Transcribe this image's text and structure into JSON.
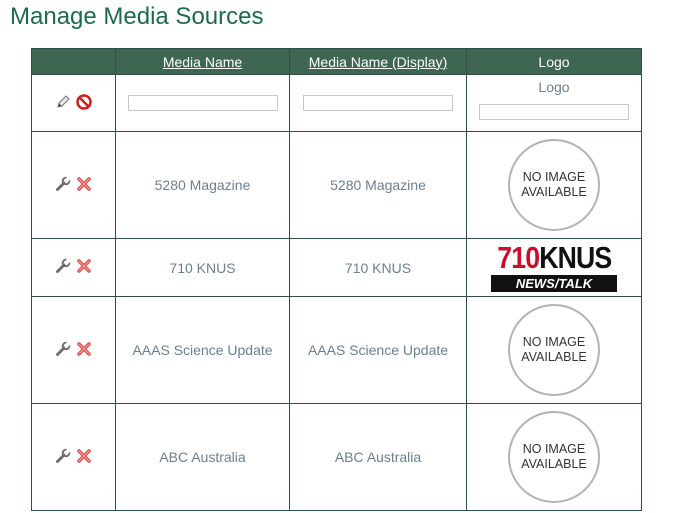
{
  "page": {
    "title": "Manage Media Sources"
  },
  "table": {
    "headers": {
      "media_name": "Media Name",
      "media_name_display": "Media Name (Display)",
      "logo": "Logo"
    },
    "filter": {
      "logo_label": "Logo"
    },
    "no_image": {
      "line1": "NO IMAGE",
      "line2": "AVAILABLE"
    },
    "rows": [
      {
        "name": "5280 Magazine",
        "display": "5280 Magazine",
        "logo": "none"
      },
      {
        "name": "710 KNUS",
        "display": "710 KNUS",
        "logo": "710-knus"
      },
      {
        "name": "AAAS Science Update",
        "display": "AAAS Science Update",
        "logo": "none"
      },
      {
        "name": "ABC Australia",
        "display": "ABC Australia",
        "logo": "none"
      }
    ]
  },
  "knus_logo": {
    "number": "710",
    "name": "KNUS",
    "tagline": "NEWS/TALK"
  },
  "icons": {
    "filter_apply": "pencil-icon",
    "filter_clear": "cancel-icon",
    "edit": "wrench-icon",
    "delete": "delete-x-icon"
  },
  "colors": {
    "header_bg": "#3e6650",
    "title": "#1e6b4a",
    "cell_text": "#6b7f8e",
    "delete": "#d9534f"
  }
}
